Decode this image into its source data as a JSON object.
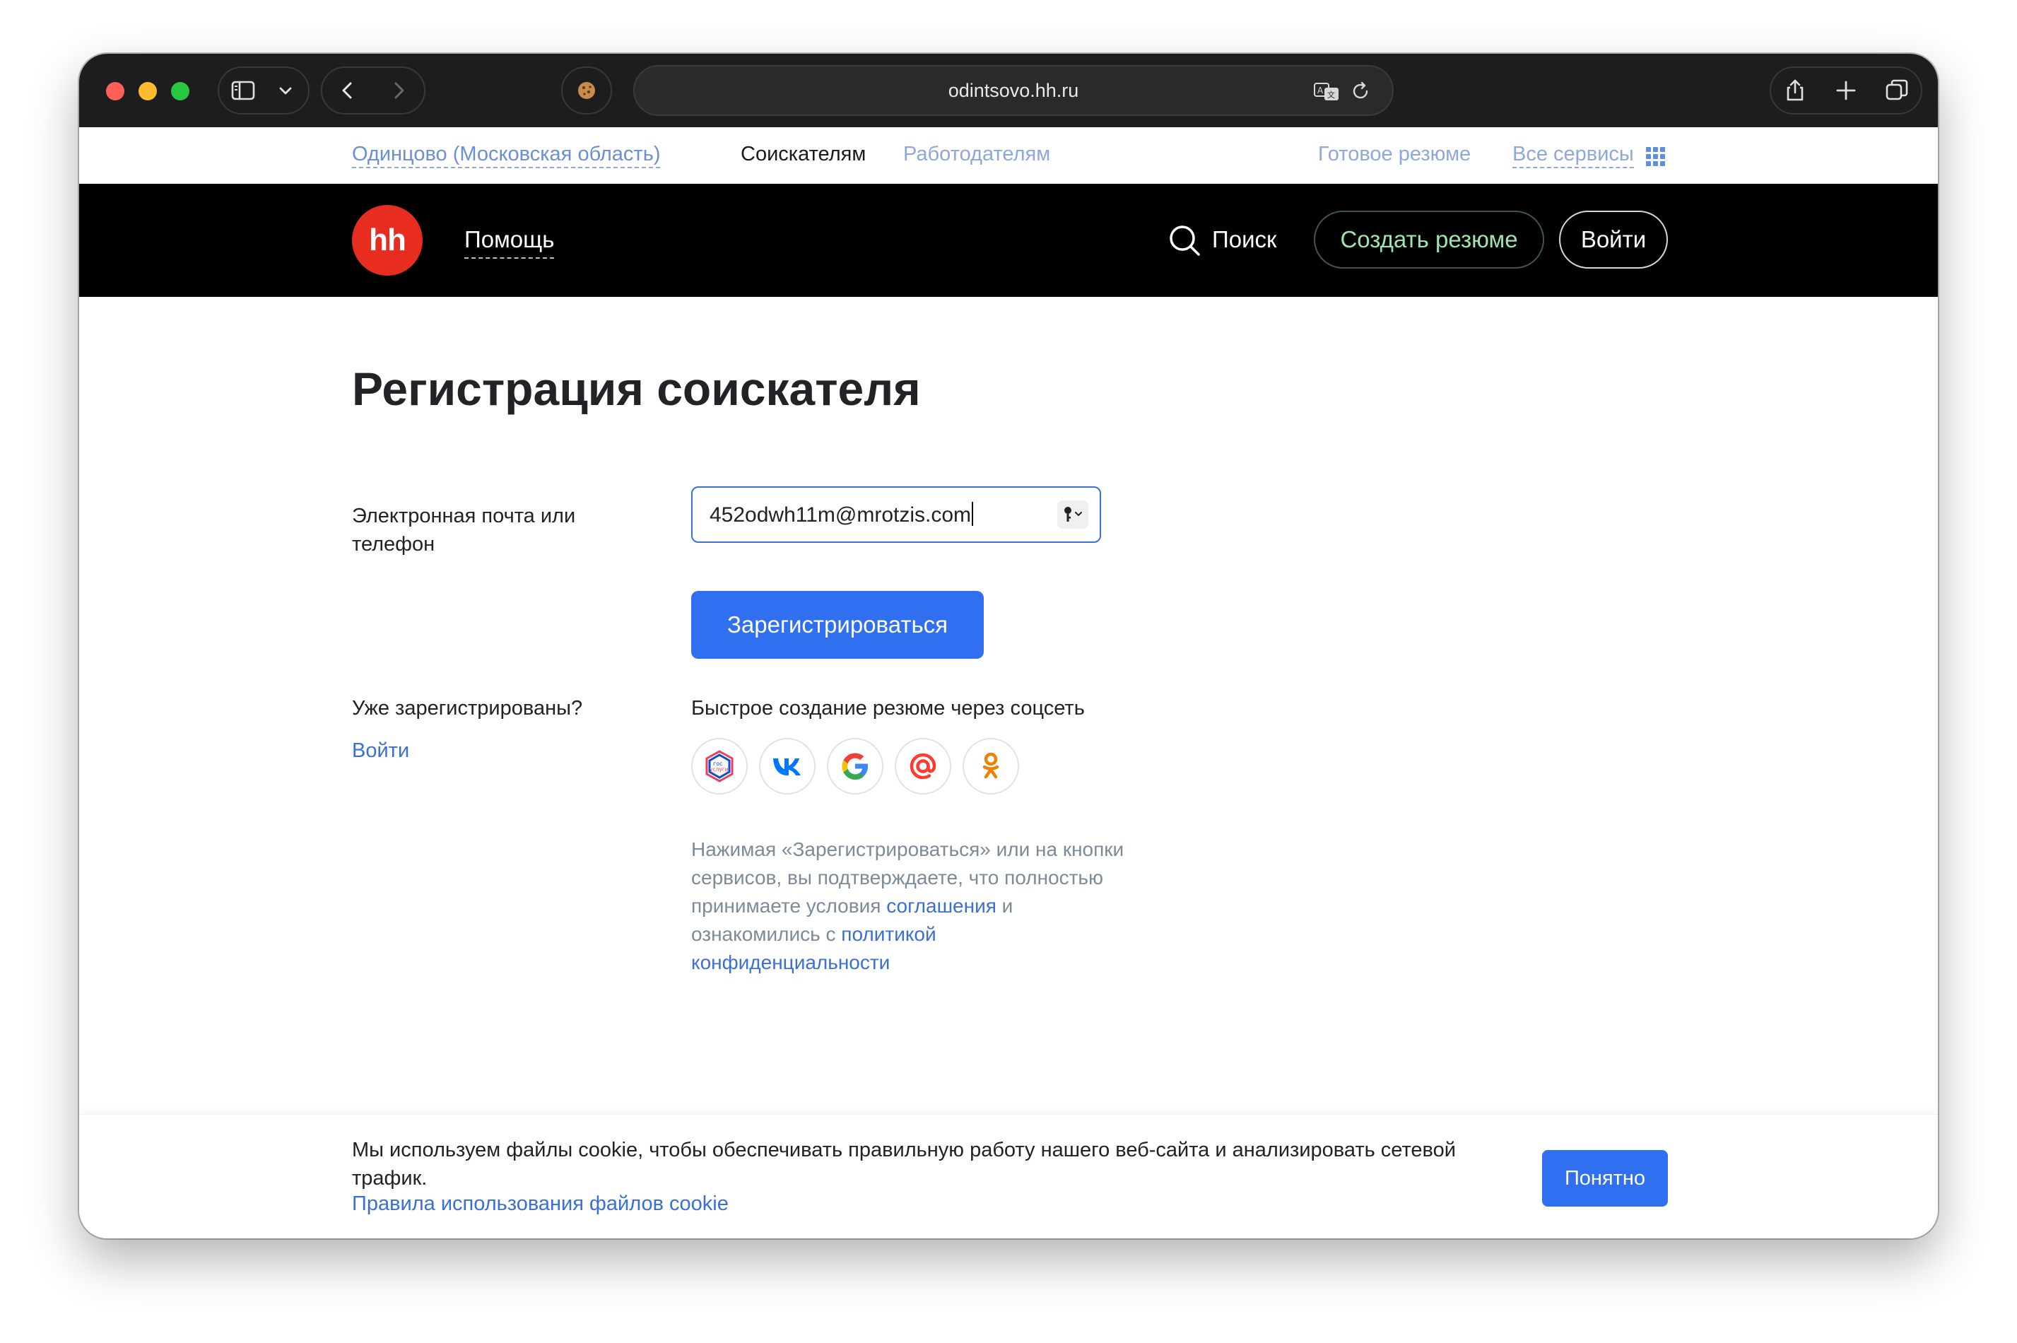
{
  "browser": {
    "url": "odintsovo.hh.ru"
  },
  "topbar": {
    "city": "Одинцово (Московская область)",
    "seekers": "Соискателям",
    "employers": "Работодателям",
    "ready_resume": "Готовое резюме",
    "all_services": "Все сервисы"
  },
  "nav": {
    "logo": "hh",
    "help": "Помощь",
    "search": "Поиск",
    "create_resume": "Создать резюме",
    "login": "Войти"
  },
  "main": {
    "title": "Регистрация соискателя",
    "email_label": "Электронная почта или телефон",
    "email_value": "452odwh11m@mrotzis.com",
    "register_button": "Зарегистрироваться",
    "already_registered": "Уже зарегистрированы?",
    "login_link": "Войти",
    "social_title": "Быстрое создание резюме через соцсеть",
    "social_buttons": [
      {
        "name": "gosuslugi",
        "label": "гос услуги"
      },
      {
        "name": "vk",
        "label": "VK"
      },
      {
        "name": "google",
        "label": "G"
      },
      {
        "name": "mail",
        "label": "@"
      },
      {
        "name": "ok",
        "label": "OK"
      }
    ],
    "terms": {
      "part1": "Нажимая «Зарегистрироваться» или на кнопки сервисов, вы подтверждаете, что полностью принимаете условия",
      "agreement_link": "соглашения",
      "part2": "и ознакомились с",
      "privacy_link": "политикой конфиденциальности"
    }
  },
  "cookie": {
    "text": "Мы используем файлы cookie, чтобы обеспечивать правильную работу нашего веб-сайта и анализировать сетевой трафик.",
    "link": "Правила использования файлов cookie",
    "ok_button": "Понятно"
  },
  "colors": {
    "brand_red": "#e62d20",
    "primary_blue": "#2f6ff0",
    "link_blue": "#3a6fd6",
    "nav_black": "#000000",
    "create_resume_green": "#9fe3ad"
  }
}
